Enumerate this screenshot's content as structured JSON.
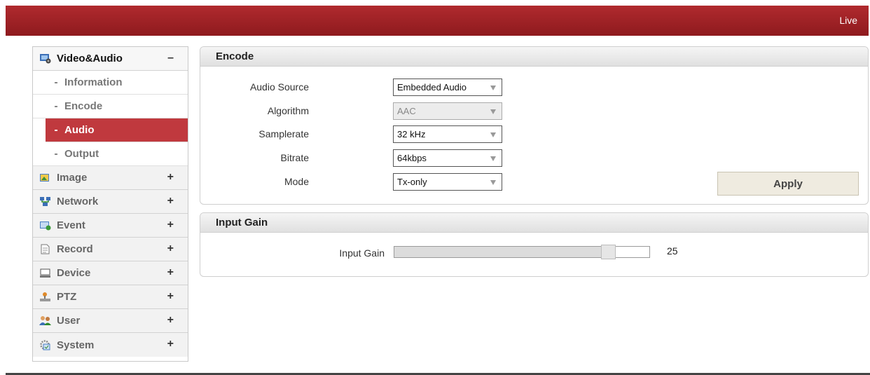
{
  "header": {
    "live_label": "Live"
  },
  "sidebar": {
    "video_audio": {
      "label": "Video&Audio",
      "toggle": "–",
      "items": [
        "Information",
        "Encode",
        "Audio",
        "Output"
      ]
    },
    "groups": [
      {
        "label": "Image",
        "toggle": "+",
        "icon": "image-icon"
      },
      {
        "label": "Network",
        "toggle": "+",
        "icon": "network-icon"
      },
      {
        "label": "Event",
        "toggle": "+",
        "icon": "event-icon"
      },
      {
        "label": "Record",
        "toggle": "+",
        "icon": "record-icon"
      },
      {
        "label": "Device",
        "toggle": "+",
        "icon": "device-icon"
      },
      {
        "label": "PTZ",
        "toggle": "+",
        "icon": "ptz-icon"
      },
      {
        "label": "User",
        "toggle": "+",
        "icon": "user-icon"
      },
      {
        "label": "System",
        "toggle": "+",
        "icon": "system-icon"
      }
    ]
  },
  "encode": {
    "title": "Encode",
    "audio_source": {
      "label": "Audio Source",
      "value": "Embedded Audio"
    },
    "algorithm": {
      "label": "Algorithm",
      "value": "AAC"
    },
    "samplerate": {
      "label": "Samplerate",
      "value": "32 kHz"
    },
    "bitrate": {
      "label": "Bitrate",
      "value": "64kbps"
    },
    "mode": {
      "label": "Mode",
      "value": "Tx-only"
    },
    "apply_label": "Apply"
  },
  "input_gain": {
    "title": "Input Gain",
    "label": "Input Gain",
    "value": "25",
    "level_fraction": 0.86
  },
  "colors": {
    "accent": "#c0393e",
    "topbar": "#a02227"
  }
}
